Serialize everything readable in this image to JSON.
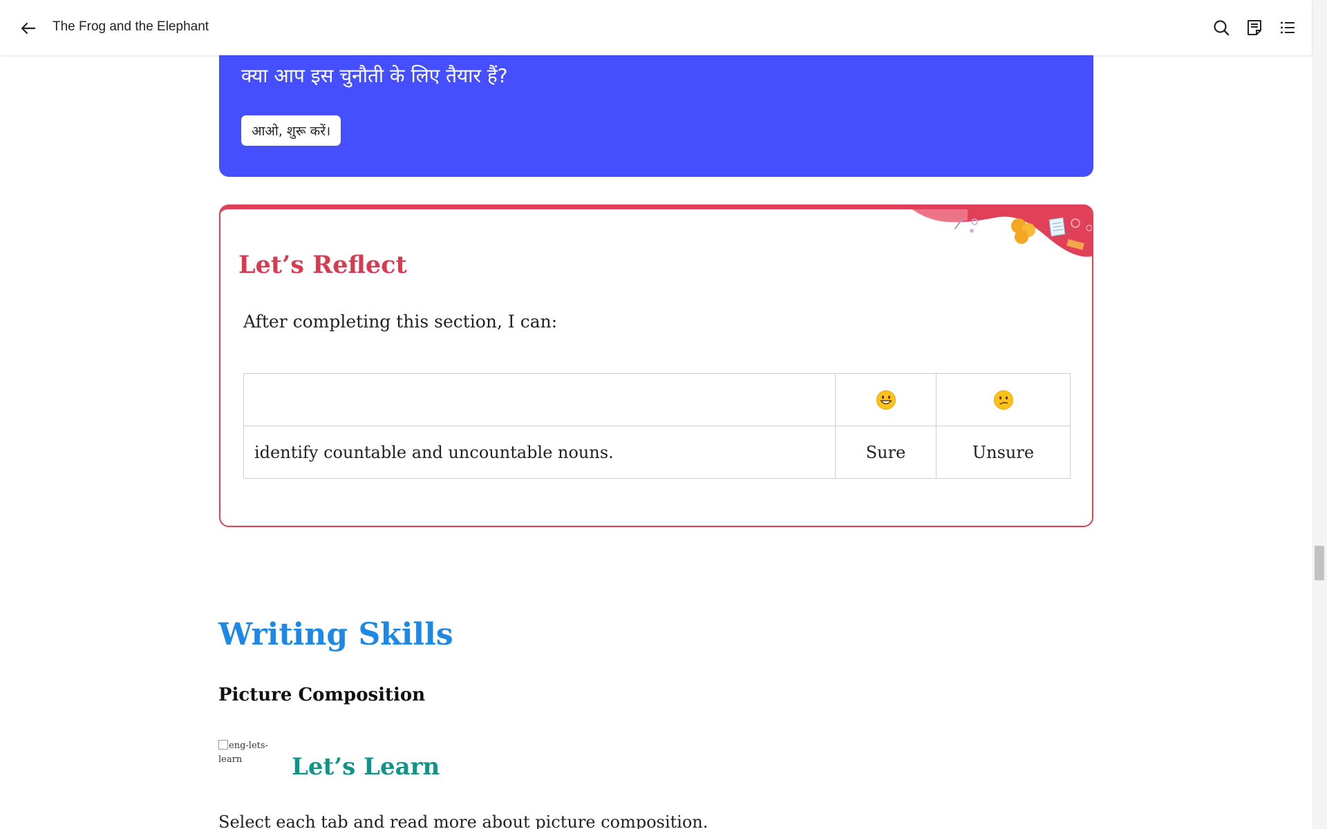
{
  "header": {
    "title": "The Frog and the Elephant",
    "icons": [
      "back-arrow-icon",
      "search-icon",
      "notes-icon",
      "contents-list-icon"
    ]
  },
  "challenge_card": {
    "question": "क्या आप इस चुनौती के लिए तैयार हैं?",
    "button_label": "आओ, शुरू करें।",
    "bg_color": "#464ffe"
  },
  "reflect": {
    "title": "Let’s Reflect",
    "subtitle": "After completing this section, I can:",
    "accent_color": "#e04158",
    "table": {
      "header": [
        "",
        "😀",
        "😕"
      ],
      "rows": [
        {
          "statement": "identify countable and uncountable nouns.",
          "sure": "Sure",
          "unsure": "Unsure"
        }
      ]
    }
  },
  "writing_skills": {
    "heading": "Writing Skills",
    "subheading": "Picture Composition",
    "image_alt": "eng-lets-learn",
    "learn_heading": "Let’s Learn",
    "paragraph": "Select each tab and read more about picture composition."
  },
  "colors": {
    "writing_heading": "#1e88e5",
    "learn_heading": "#0f9488"
  }
}
